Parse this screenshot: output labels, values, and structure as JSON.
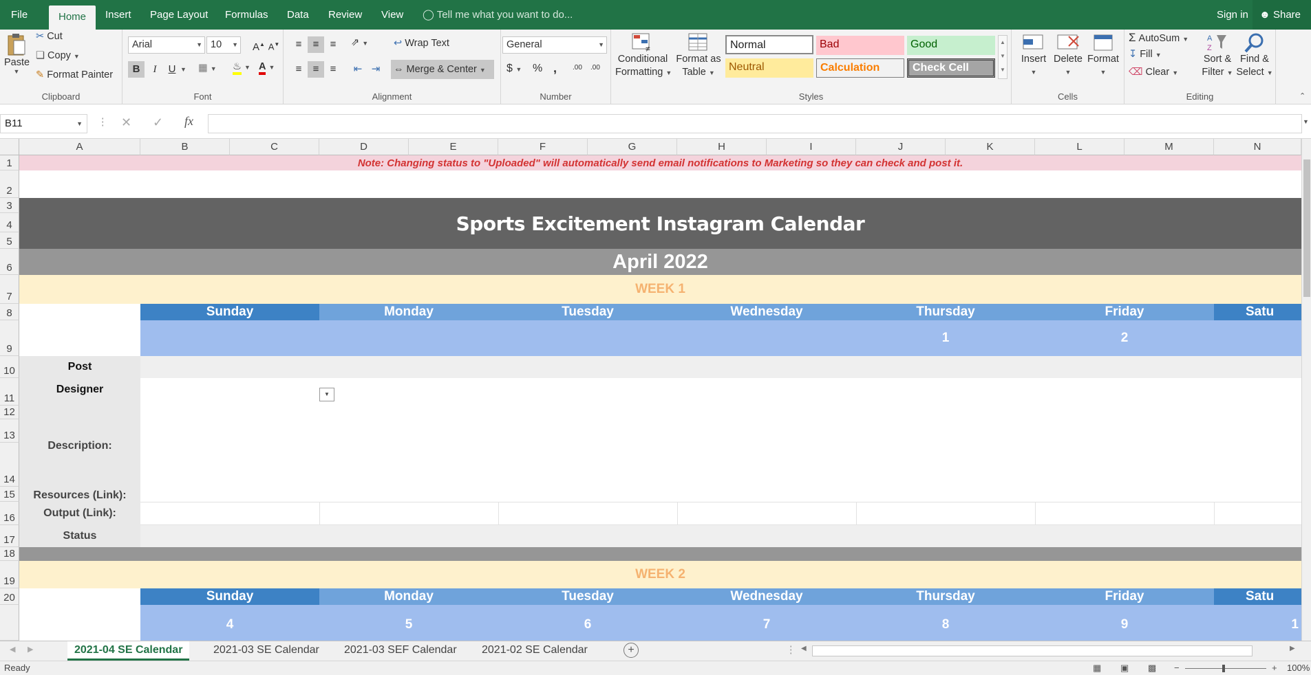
{
  "titlebar": {
    "tabs": [
      "File",
      "Home",
      "Insert",
      "Page Layout",
      "Formulas",
      "Data",
      "Review",
      "View"
    ],
    "active_tab": "Home",
    "tell_me": "Tell me what you want to do...",
    "sign_in": "Sign in",
    "share": "Share"
  },
  "ribbon": {
    "clipboard": {
      "paste": "Paste",
      "cut": "Cut",
      "copy": "Copy",
      "format_painter": "Format Painter",
      "label": "Clipboard"
    },
    "font": {
      "name": "Arial",
      "size": "10",
      "bold": "B",
      "italic": "I",
      "underline": "U",
      "label": "Font"
    },
    "alignment": {
      "wrap": "Wrap Text",
      "merge": "Merge & Center",
      "label": "Alignment"
    },
    "number": {
      "format": "General",
      "currency": "$",
      "percent": "%",
      "comma": ",",
      "inc": ".00",
      "dec": ".00",
      "label": "Number"
    },
    "styles": {
      "cond_fmt_1": "Conditional",
      "cond_fmt_2": "Formatting",
      "format_as_1": "Format as",
      "format_as_2": "Table",
      "normal": "Normal",
      "bad": "Bad",
      "good": "Good",
      "neutral": "Neutral",
      "calculation": "Calculation",
      "check_cell": "Check Cell",
      "label": "Styles"
    },
    "cells": {
      "insert": "Insert",
      "delete": "Delete",
      "format": "Format",
      "label": "Cells"
    },
    "editing": {
      "autosum": "AutoSum",
      "fill": "Fill",
      "clear": "Clear",
      "sort_1": "Sort &",
      "sort_2": "Filter",
      "find_1": "Find &",
      "find_2": "Select",
      "label": "Editing"
    }
  },
  "formula_bar": {
    "name_box": "B11",
    "content": ""
  },
  "columns": [
    "A",
    "B",
    "C",
    "D",
    "E",
    "F",
    "G",
    "H",
    "I",
    "J",
    "K",
    "L",
    "M",
    "N"
  ],
  "rows": [
    "1",
    "2",
    "3",
    "4",
    "5",
    "6",
    "7",
    "8",
    "9",
    "10",
    "11",
    "12",
    "13",
    "14",
    "15",
    "16",
    "17",
    "18",
    "19",
    "20"
  ],
  "sheet": {
    "note": "Note: Changing status to \"Uploaded\" will automatically send email notifications to Marketing so they can check and post it.",
    "title": "Sports Excitement Instagram Calendar",
    "month": "April 2022",
    "week1": "WEEK 1",
    "week2": "WEEK 2",
    "days": [
      "Sunday",
      "Monday",
      "Tuesday",
      "Wednesday",
      "Thursday",
      "Friday",
      "Satu"
    ],
    "week1_dates": [
      "",
      "",
      "",
      "",
      "1",
      "2",
      ""
    ],
    "week2_dates": [
      "4",
      "5",
      "6",
      "7",
      "8",
      "9",
      "1"
    ],
    "labels": {
      "post": "Post",
      "designer": "Designer",
      "description": "Description:",
      "resources": "Resources (Link):",
      "output": "Output (Link):",
      "status": "Status"
    }
  },
  "sheet_tabs": [
    "2021-04 SE Calendar",
    "2021-03 SE Calendar",
    "2021-03 SEF Calendar",
    "2021-02 SE Calendar"
  ],
  "status": {
    "ready": "Ready",
    "zoom": "100%"
  },
  "colors": {
    "excel_green": "#217346",
    "note_bg": "#f4d3dc",
    "note_text": "#d33333",
    "title_bg": "#636363",
    "month_bg": "#969696",
    "week_bg": "#fef1cd",
    "week_text": "#f5b270",
    "day_dark": "#3d82c5",
    "day_light": "#6fa3db",
    "date_bg": "#9fbdee"
  }
}
